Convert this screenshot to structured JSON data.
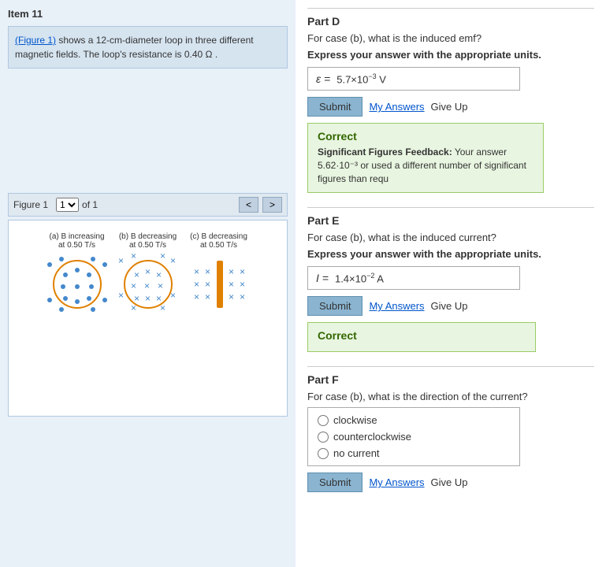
{
  "item": {
    "title": "Item 11",
    "description_part1": "(Figure 1)",
    "description_part2": " shows a 12-cm-diameter loop in three different magnetic fields. The loop's resistance is 0.40 Ω ."
  },
  "figure": {
    "label": "Figure 1",
    "of_label": "of 1",
    "nav_prev": "<",
    "nav_next": ">",
    "diagrams": [
      {
        "id": "a",
        "label_line1": "(a) B increasing",
        "label_line2": "at 0.50 T/s",
        "type": "dots-circle"
      },
      {
        "id": "b",
        "label_line1": "(b) B decreasing",
        "label_line2": "at 0.50 T/s",
        "type": "crosses-circle"
      },
      {
        "id": "c",
        "label_line1": "(c) B decreasing",
        "label_line2": "at 0.50 T/s",
        "type": "crosses-bar"
      }
    ]
  },
  "parts": {
    "D": {
      "title": "Part D",
      "question": "For case (b), what is the induced emf?",
      "instruction": "Express your answer with the appropriate units.",
      "answer_symbol": "ε =",
      "answer_value": "5.7×10",
      "answer_exp": "−3",
      "answer_unit": "V",
      "submit_label": "Submit",
      "my_answers_label": "My Answers",
      "give_up_label": "Give Up",
      "correct": {
        "title": "Correct",
        "feedback_bold": "Significant Figures Feedback:",
        "feedback_text": " Your answer 5.62·10⁻³ or used a different number of significant figures than requ"
      }
    },
    "E": {
      "title": "Part E",
      "question": "For case (b), what is the induced current?",
      "instruction": "Express your answer with the appropriate units.",
      "answer_symbol": "I =",
      "answer_value": "1.4×10",
      "answer_exp": "−2",
      "answer_unit": "A",
      "submit_label": "Submit",
      "my_answers_label": "My Answers",
      "give_up_label": "Give Up",
      "correct": {
        "title": "Correct"
      }
    },
    "F": {
      "title": "Part F",
      "question": "For case (b), what is the direction of the current?",
      "submit_label": "Submit",
      "my_answers_label": "My Answers",
      "give_up_label": "Give Up",
      "options": [
        {
          "id": "cw",
          "label": "clockwise"
        },
        {
          "id": "ccw",
          "label": "counterclockwise"
        },
        {
          "id": "nc",
          "label": "no current"
        }
      ]
    }
  }
}
